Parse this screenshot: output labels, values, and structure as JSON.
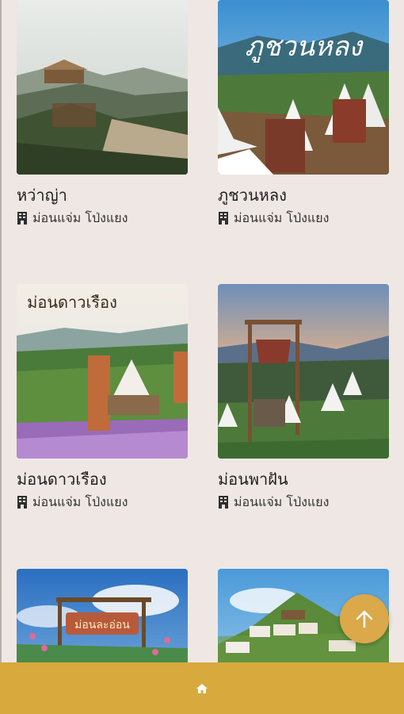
{
  "places": [
    {
      "name": "หว่าญ่า",
      "location": "ม่อนแจ่ม โป่งแยง",
      "image": "mountain-homestay-photo"
    },
    {
      "name": "ภูชวนหลง",
      "location": "ม่อนแจ่ม โป่งแยง",
      "image": "tent-camp-photo",
      "overlay_text": "ภูชวนหลง"
    },
    {
      "name": "ม่อนดาวเรือง",
      "location": "ม่อนแจ่ม โป่งแยง",
      "image": "flower-field-tent-photo",
      "overlay_text": "ม่อนดาวเรือง"
    },
    {
      "name": "ม่อนพาฝัน",
      "location": "ม่อนแจ่ม โป่งแยง",
      "image": "sunset-camp-photo"
    },
    {
      "name": "",
      "location": "",
      "image": "flower-sign-photo",
      "overlay_text": "ม่อนละอ่อน"
    },
    {
      "name": "",
      "location": "",
      "image": "hillside-village-photo"
    }
  ],
  "bottom_nav": {
    "home_icon": "home-icon"
  },
  "fab": {
    "icon": "arrow-up-icon"
  },
  "colors": {
    "accent": "#d8a93d",
    "fab": "#dba84a",
    "background": "#efe7e4"
  }
}
